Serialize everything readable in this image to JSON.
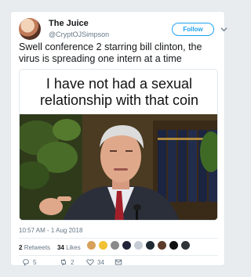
{
  "user": {
    "name": "The Juice",
    "handle": "@CryptOJSimpson",
    "follow_label": "Follow"
  },
  "tweet": {
    "text": "Swell conference 2  starring bill clinton, the virus is spreading one intern at a time"
  },
  "meme": {
    "caption": "I have not had a sexual relationship with that coin"
  },
  "meta": {
    "timestamp": "10:57 AM - 1 Aug 2018"
  },
  "stats": {
    "retweets": "2",
    "retweets_label": "Retweets",
    "likes": "34",
    "likes_label": "Likes"
  },
  "actions": {
    "reply_count": "5",
    "retweet_count": "2",
    "like_count": "34"
  },
  "colors": {
    "accent": "#1da1f2",
    "muted": "#657786",
    "text": "#14171a"
  },
  "icons": [
    "chevron-down-icon",
    "reply-icon",
    "retweet-icon",
    "heart-icon",
    "message-icon"
  ]
}
